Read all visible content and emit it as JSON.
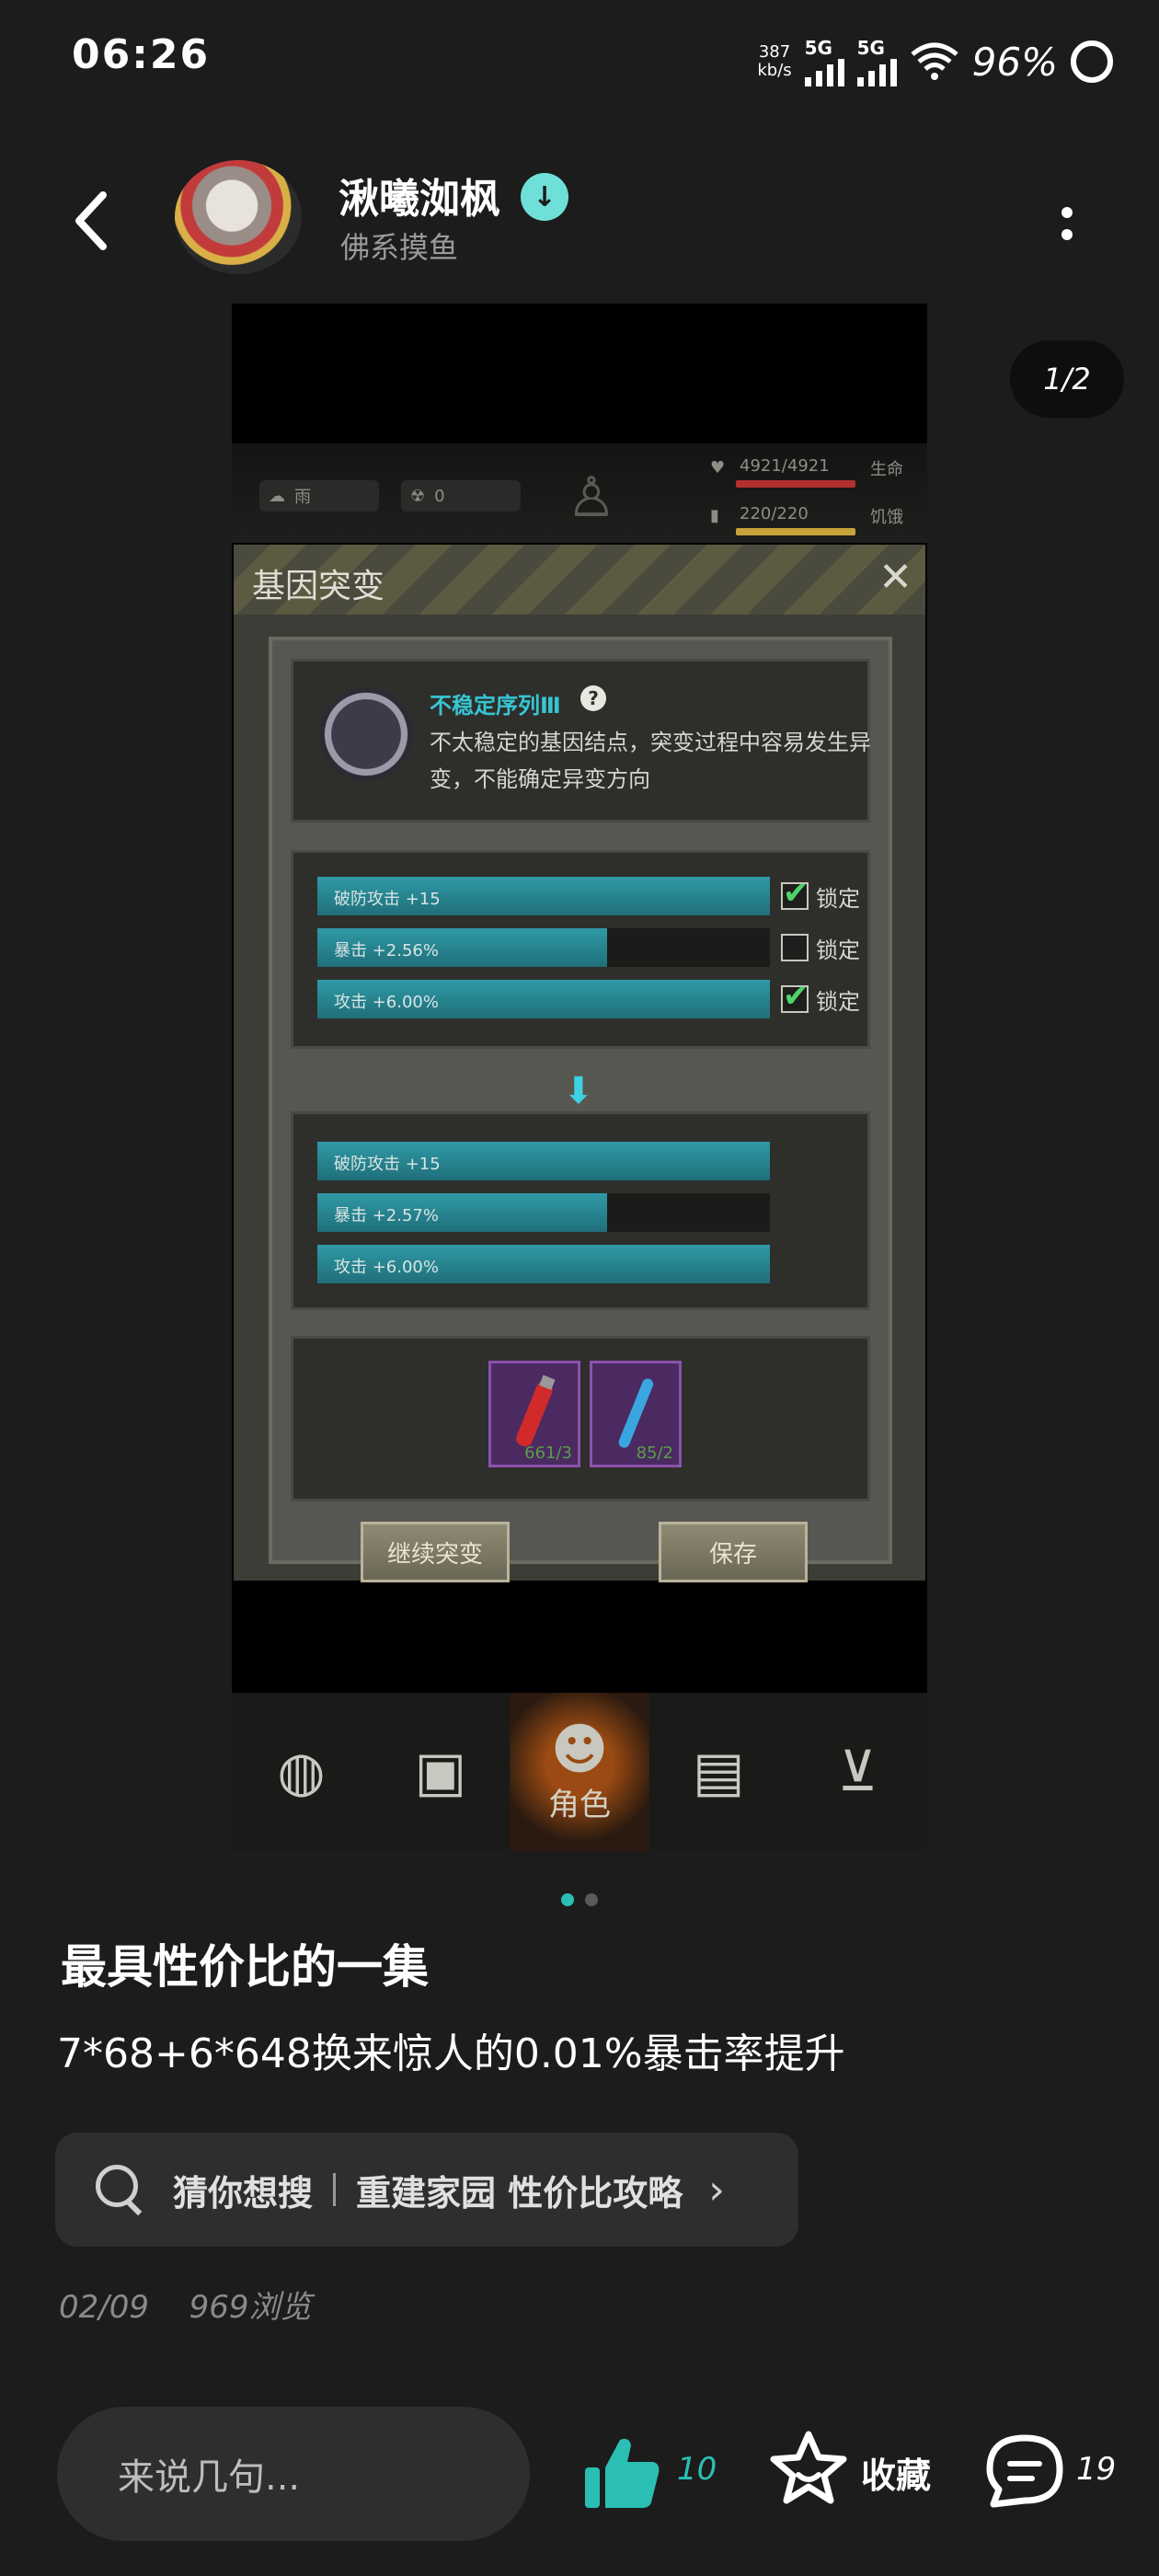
{
  "status_bar": {
    "time": "06:26",
    "speed_value": "387",
    "speed_unit": "kb/s",
    "signal1": "5G",
    "signal2": "5G",
    "battery": "96%"
  },
  "header": {
    "author_name": "湫曦洳枫",
    "author_subtitle": "佛系摸鱼",
    "verified_icon": "verified-badge-icon"
  },
  "page_indicator": "1/2",
  "game": {
    "weather": "雨",
    "radiation": "0",
    "hp_value": "4921/4921",
    "hp_label": "生命",
    "hp_fraction": 1.0,
    "food_value": "220/220",
    "food_label": "饥饿",
    "food_fraction": 1.0,
    "dialog_title": "基因突变",
    "gene": {
      "name": "不稳定序列Ⅲ",
      "description": "不太稳定的基因结点，突变过程中容易发生异变，不能确定异变方向"
    },
    "current_stats": [
      {
        "label": "破防攻击 +15",
        "fill": 1.0,
        "locked": true
      },
      {
        "label": "暴击 +2.56%",
        "fill": 0.64,
        "locked": false
      },
      {
        "label": "攻击 +6.00%",
        "fill": 1.0,
        "locked": true
      }
    ],
    "lock_label": "锁定",
    "new_stats": [
      {
        "label": "破防攻击 +15",
        "fill": 1.0
      },
      {
        "label": "暴击 +2.57%",
        "fill": 0.64
      },
      {
        "label": "攻击 +6.00%",
        "fill": 1.0
      }
    ],
    "items": [
      {
        "count": "661/3",
        "icon": "red-vial-icon"
      },
      {
        "count": "85/2",
        "icon": "blue-vial-icon"
      }
    ],
    "continue_button": "继续突变",
    "save_button": "保存",
    "tabs": [
      {
        "icon": "globe-icon",
        "label": ""
      },
      {
        "icon": "backpack-icon",
        "label": ""
      },
      {
        "icon": "character-icon",
        "label": "角色"
      },
      {
        "icon": "radio-icon",
        "label": ""
      },
      {
        "icon": "cart-icon",
        "label": ""
      }
    ]
  },
  "post": {
    "title": "最具性价比的一集",
    "body": "7*68+6*648换来惊人的0.01%暴击率提升",
    "search_hint": "猜你想搜",
    "search_term": "重建家园 性价比攻略",
    "date": "02/09",
    "views": "969浏览"
  },
  "bottom_bar": {
    "comment_placeholder": "来说几句...",
    "like_count": "10",
    "favorite_label": "收藏",
    "comment_count": "19"
  },
  "colors": {
    "background": "#1c1c1c",
    "accent": "#2bbfb4",
    "like": "#2bbfb4"
  }
}
